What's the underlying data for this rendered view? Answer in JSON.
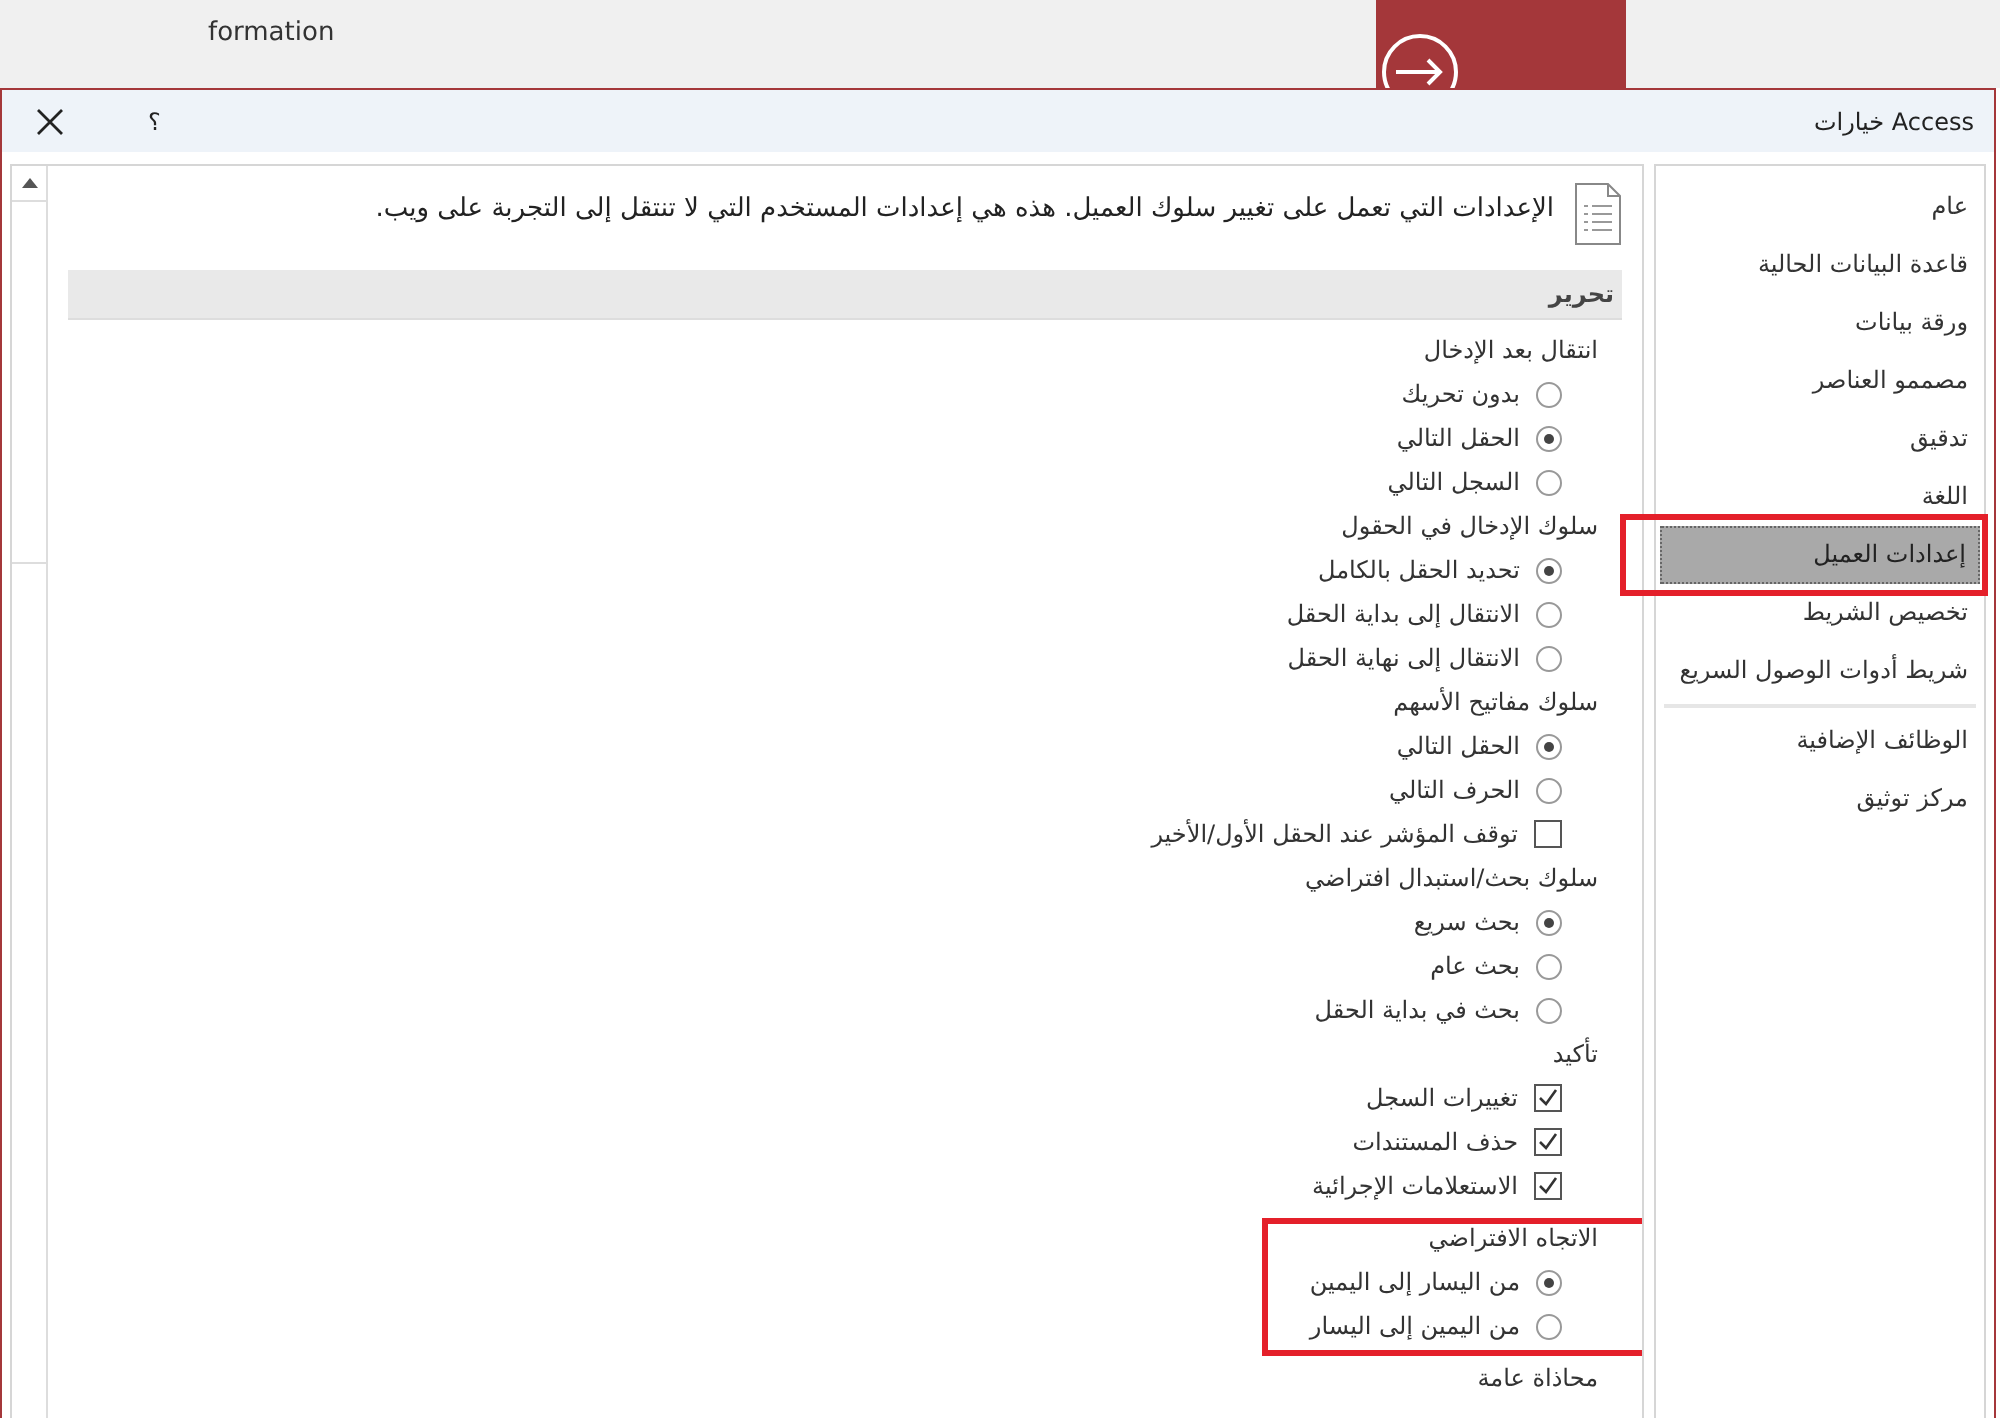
{
  "background_app": {
    "tab_text": "formation"
  },
  "dialog": {
    "title": "خيارات Access",
    "help": "؟"
  },
  "nav": {
    "groups": [
      [
        {
          "label": "عام",
          "selected": false,
          "highlighted": false
        },
        {
          "label": "قاعدة البيانات الحالية",
          "selected": false,
          "highlighted": false
        },
        {
          "label": "ورقة بيانات",
          "selected": false,
          "highlighted": false
        },
        {
          "label": "مصممو العناصر",
          "selected": false,
          "highlighted": false
        },
        {
          "label": "تدقيق",
          "selected": false,
          "highlighted": false
        },
        {
          "label": "اللغة",
          "selected": false,
          "highlighted": false
        },
        {
          "label": "إعدادات العميل",
          "selected": true,
          "highlighted": true
        },
        {
          "label": "تخصيص الشريط",
          "selected": false,
          "highlighted": false
        },
        {
          "label": "شريط أدوات الوصول السريع",
          "selected": false,
          "highlighted": false
        }
      ],
      [
        {
          "label": "الوظائف الإضافية",
          "selected": false,
          "highlighted": false
        },
        {
          "label": "مركز توثيق",
          "selected": false,
          "highlighted": false
        }
      ]
    ]
  },
  "content": {
    "description": "الإعدادات التي تعمل على تغيير سلوك العميل. هذه هي إعدادات المستخدم التي لا تنتقل إلى التجربة على ويب.",
    "section_title": "تحرير",
    "groups": [
      {
        "label": "انتقال بعد الإدخال",
        "highlighted": false,
        "items": [
          {
            "kind": "radio",
            "label": "بدون تحريك",
            "selected": false
          },
          {
            "kind": "radio",
            "label": "الحقل التالي",
            "selected": true
          },
          {
            "kind": "radio",
            "label": "السجل التالي",
            "selected": false
          }
        ]
      },
      {
        "label": "سلوك الإدخال في الحقول",
        "highlighted": false,
        "items": [
          {
            "kind": "radio",
            "label": "تحديد الحقل بالكامل",
            "selected": true
          },
          {
            "kind": "radio",
            "label": "الانتقال إلى بداية الحقل",
            "selected": false
          },
          {
            "kind": "radio",
            "label": "الانتقال إلى نهاية الحقل",
            "selected": false
          }
        ]
      },
      {
        "label": "سلوك مفاتيح الأسهم",
        "highlighted": false,
        "items": [
          {
            "kind": "radio",
            "label": "الحقل التالي",
            "selected": true
          },
          {
            "kind": "radio",
            "label": "الحرف التالي",
            "selected": false
          }
        ]
      },
      {
        "highlighted": false,
        "items": [
          {
            "kind": "checkbox",
            "label": "توقف المؤشر عند الحقل الأول/الأخير",
            "checked": false
          }
        ]
      },
      {
        "label": "سلوك بحث/استبدال افتراضي",
        "highlighted": false,
        "items": [
          {
            "kind": "radio",
            "label": "بحث سريع",
            "selected": true
          },
          {
            "kind": "radio",
            "label": "بحث عام",
            "selected": false
          },
          {
            "kind": "radio",
            "label": "بحث في بداية الحقل",
            "selected": false
          }
        ]
      },
      {
        "label": "تأكيد",
        "highlighted": false,
        "items": [
          {
            "kind": "checkbox",
            "label": "تغييرات السجل",
            "checked": true
          },
          {
            "kind": "checkbox",
            "label": "حذف المستندات",
            "checked": true
          },
          {
            "kind": "checkbox",
            "label": "الاستعلامات الإجرائية",
            "checked": true
          }
        ]
      },
      {
        "label": "الاتجاه الافتراضي",
        "highlighted": true,
        "items": [
          {
            "kind": "radio",
            "label": "من اليسار إلى اليمين",
            "selected": true
          },
          {
            "kind": "radio",
            "label": "من اليمين إلى اليسار",
            "selected": false
          }
        ]
      },
      {
        "label": "محاذاة عامة",
        "highlighted": false
      }
    ]
  }
}
